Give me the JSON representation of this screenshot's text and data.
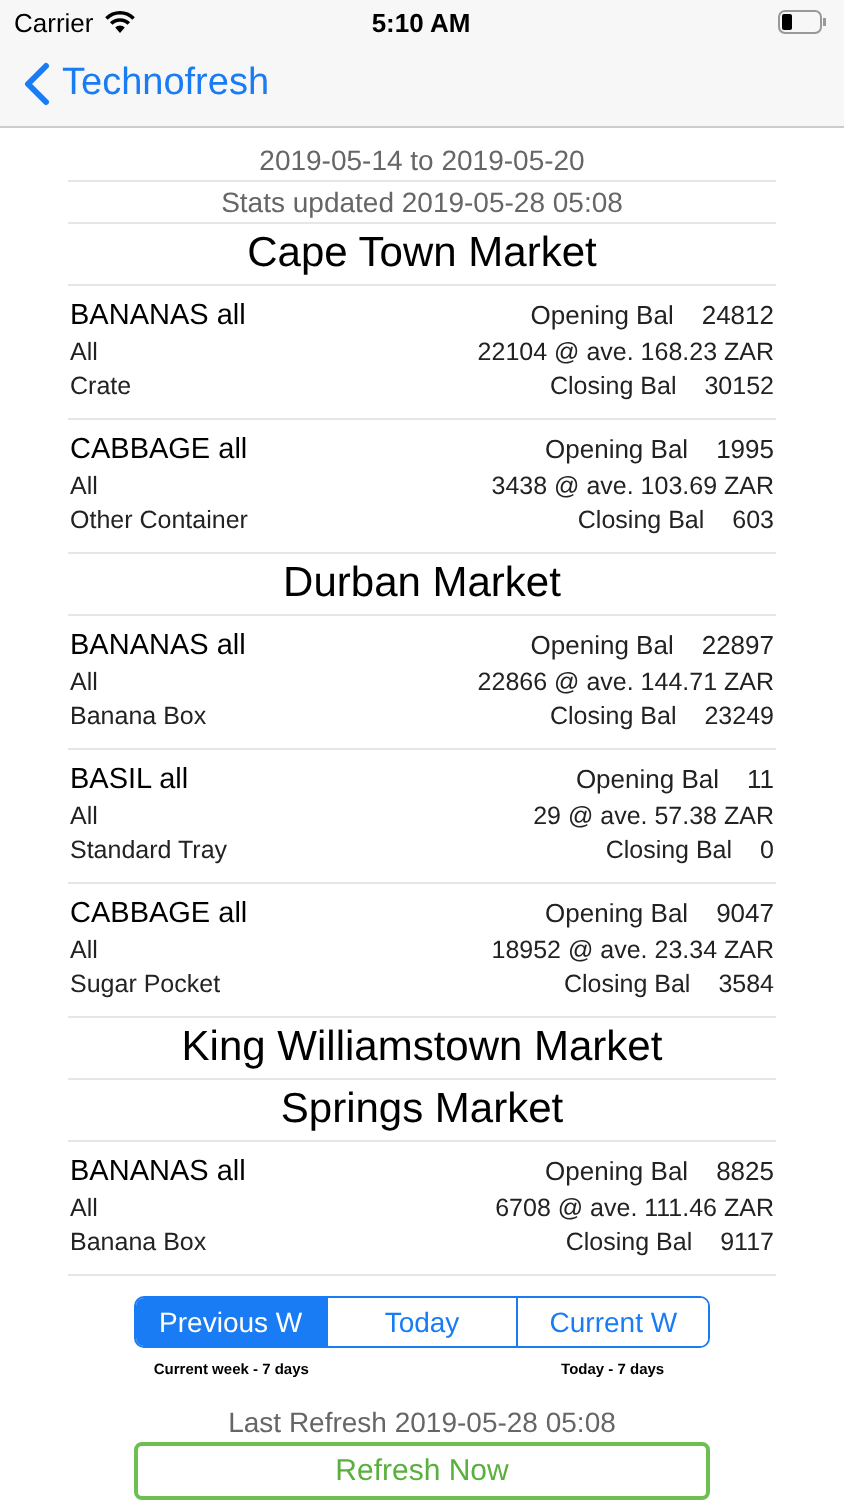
{
  "status_bar": {
    "carrier": "Carrier",
    "time": "5:10 AM"
  },
  "nav_bar": {
    "back_label": "Technofresh"
  },
  "header": {
    "date_range": "2019-05-14 to 2019-05-20",
    "stats_updated": "Stats updated 2019-05-28 05:08"
  },
  "markets": [
    {
      "name": "Cape Town Market",
      "items": [
        {
          "product": "BANANAS all",
          "variety": "All",
          "container": "Crate",
          "opening_label": "Opening Bal",
          "opening": "24812",
          "sales": "22104 @ ave. 168.23 ZAR",
          "closing_label": "Closing Bal",
          "closing": "30152"
        },
        {
          "product": "CABBAGE all",
          "variety": "All",
          "container": "Other Container",
          "opening_label": "Opening Bal",
          "opening": "1995",
          "sales": "3438 @ ave. 103.69 ZAR",
          "closing_label": "Closing Bal",
          "closing": "603"
        }
      ]
    },
    {
      "name": "Durban Market",
      "items": [
        {
          "product": "BANANAS all",
          "variety": "All",
          "container": "Banana Box",
          "opening_label": "Opening Bal",
          "opening": "22897",
          "sales": "22866 @ ave. 144.71 ZAR",
          "closing_label": "Closing Bal",
          "closing": "23249"
        },
        {
          "product": "BASIL all",
          "variety": "All",
          "container": "Standard Tray",
          "opening_label": "Opening Bal",
          "opening": "11",
          "sales": "29 @ ave. 57.38 ZAR",
          "closing_label": "Closing Bal",
          "closing": "0"
        },
        {
          "product": "CABBAGE all",
          "variety": "All",
          "container": "Sugar Pocket",
          "opening_label": "Opening Bal",
          "opening": "9047",
          "sales": "18952 @ ave. 23.34 ZAR",
          "closing_label": "Closing Bal",
          "closing": "3584"
        }
      ]
    },
    {
      "name": "King Williamstown Market"
    },
    {
      "name": "Springs Market",
      "items": [
        {
          "product": "BANANAS all",
          "variety": "All",
          "container": "Banana Box",
          "opening_label": "Opening Bal",
          "opening": "8825",
          "sales": "6708 @ ave. 111.46 ZAR",
          "closing_label": "Closing Bal",
          "closing": "9117"
        }
      ]
    }
  ],
  "segments": [
    {
      "label": "Previous W",
      "selected": true,
      "caption": "Current week - 7 days"
    },
    {
      "label": "Today",
      "selected": false
    },
    {
      "label": "Current W",
      "selected": false,
      "caption": "Today - 7 days"
    }
  ],
  "last_refresh": "Last Refresh 2019-05-28 05:08",
  "refresh_button": "Refresh Now"
}
